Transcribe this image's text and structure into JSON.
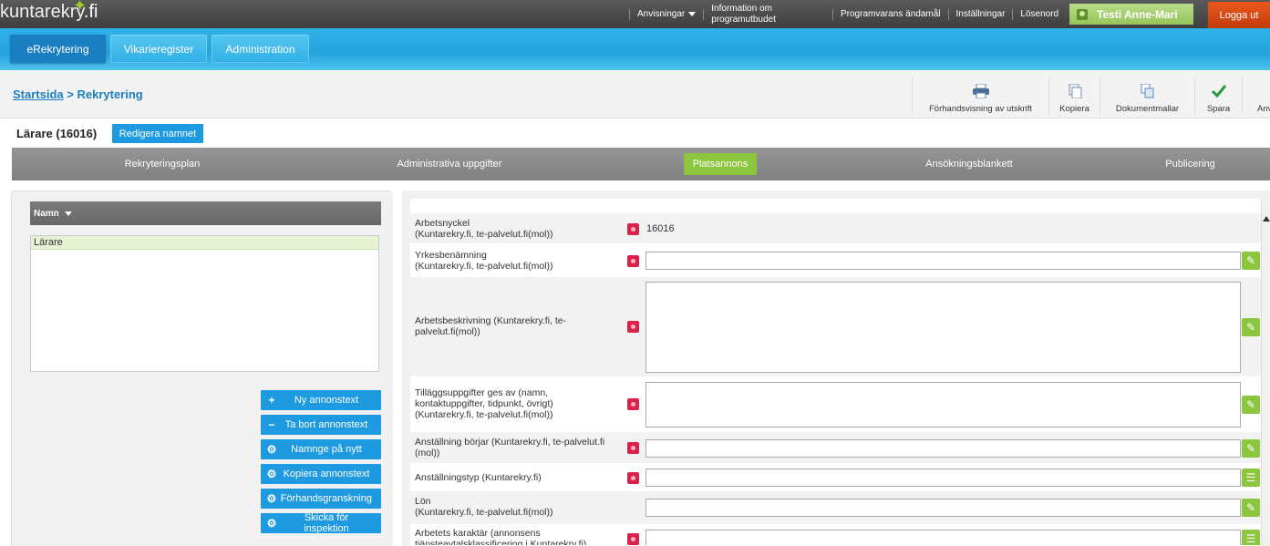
{
  "brand": {
    "logo_text": "kuntarekry",
    "logo_suffix": ".fi"
  },
  "topnav": {
    "notices": "Anvisningar",
    "info_line1": "Information om",
    "info_line2": "programutbudet",
    "purpose": "Programvarans ändamål",
    "settings": "Inställningar",
    "password": "Lösenord",
    "user": "Testi Anne-Mari",
    "logout": "Logga ut"
  },
  "nav": {
    "tabs": [
      {
        "label": "eRekrytering",
        "active": true
      },
      {
        "label": "Vikarieregister",
        "active": false
      },
      {
        "label": "Administration",
        "active": false
      }
    ]
  },
  "breadcrumb": {
    "home": "Startsida",
    "separator": ">",
    "current": "Rekrytering"
  },
  "toolbar": {
    "preview": "Förhandsvisning av utskrift",
    "copy": "Kopiera",
    "templates": "Dokumentmallar",
    "save": "Spara",
    "more": "Anv"
  },
  "title": {
    "text": "Lärare (16016)",
    "rename_button": "Redigera namnet"
  },
  "steps": [
    {
      "label": "Rekryteringsplan",
      "active": false
    },
    {
      "label": "Administrativa uppgifter",
      "active": false
    },
    {
      "label": "Platsannons",
      "active": true
    },
    {
      "label": "Ansökningsblankett",
      "active": false
    },
    {
      "label": "Publicering",
      "active": false
    }
  ],
  "left_grid": {
    "header": "Namn",
    "rows": [
      "Lärare"
    ]
  },
  "side_buttons": [
    {
      "icon": "plus-icon",
      "label": "Ny annonstext"
    },
    {
      "icon": "minus-icon",
      "label": "Ta bort annonstext"
    },
    {
      "icon": "gear-icon",
      "label": "Namnge på nytt"
    },
    {
      "icon": "gear-icon",
      "label": "Kopiera annonstext"
    },
    {
      "icon": "gear-icon",
      "label": "Förhandsgranskning"
    },
    {
      "icon": "gear-icon",
      "label": "Skicka för inspektion"
    }
  ],
  "form": {
    "fields": [
      {
        "label_l1": "Arbetsnyckel",
        "label_l2": "(Kuntarekry.fi, te-palvelut.fi(mol))",
        "label_l3": "",
        "value": "16016",
        "type": "readonly"
      },
      {
        "label_l1": "Yrkesbenämning",
        "label_l2": "(Kuntarekry.fi, te-palvelut.fi(mol))",
        "label_l3": "",
        "value": "",
        "type": "text"
      },
      {
        "label_l1": "Arbetsbeskrivning (Kuntarekry.fi, te-",
        "label_l2": "palvelut.fi(mol))",
        "label_l3": "",
        "value": "",
        "type": "textarea"
      },
      {
        "label_l1": "Tilläggsuppgifter ges av (namn,",
        "label_l2": "kontaktuppgifter, tidpunkt, övrigt)",
        "label_l3": "(Kuntarekry.fi, te-palvelut.fi(mol))",
        "value": "",
        "type": "textarea"
      },
      {
        "label_l1": "Anställning börjar (Kuntarekry.fi, te-palvelut.fi",
        "label_l2": "(mol))",
        "label_l3": "",
        "value": "",
        "type": "text"
      },
      {
        "label_l1": "Anställningstyp (Kuntarekry.fi)",
        "label_l2": "",
        "label_l3": "",
        "value": "",
        "type": "list"
      },
      {
        "label_l1": "Lön",
        "label_l2": "(Kuntarekry.fi, te-palvelut.fi(mol))",
        "label_l3": "",
        "value": "",
        "type": "text-noreq"
      },
      {
        "label_l1": "Arbetets karaktär (annonsens",
        "label_l2": "tjänsteavtalsklassificering i Kuntarekry.fi)",
        "label_l3": "",
        "value": "",
        "type": "list"
      }
    ]
  },
  "colors": {
    "accent_blue": "#1e9ae0",
    "green": "#8cc63f",
    "required_red": "#d9234b",
    "logout_orange": "#d8491a"
  }
}
